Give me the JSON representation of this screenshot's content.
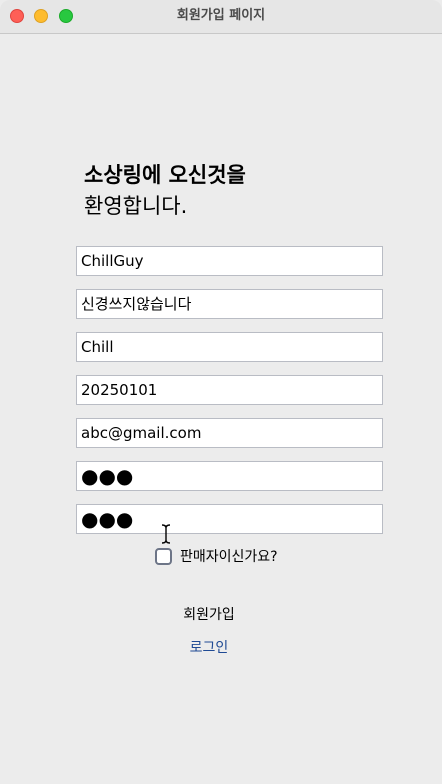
{
  "window": {
    "title": "회원가입 페이지"
  },
  "welcome": {
    "line1": "소상링에 오신것을",
    "line2": "환영합니다."
  },
  "form": {
    "fields": [
      {
        "name": "id",
        "value": "ChillGuy"
      },
      {
        "name": "name",
        "value": "신경쓰지않습니다"
      },
      {
        "name": "nickname",
        "value": "Chill"
      },
      {
        "name": "birthdate",
        "value": "20250101"
      },
      {
        "name": "email",
        "value": "abc@gmail.com"
      },
      {
        "name": "password",
        "value": "●●●"
      },
      {
        "name": "password-confirm",
        "value": "●●●"
      }
    ],
    "seller_label": "판매자이신가요?",
    "seller_checked": false
  },
  "actions": {
    "signup_label": "회원가입",
    "login_label": "로그인"
  },
  "colors": {
    "window_bg": "#ececec",
    "link": "#1f4a94",
    "close": "#fe5f57",
    "minimize": "#febc2e",
    "maximize": "#28c840"
  }
}
